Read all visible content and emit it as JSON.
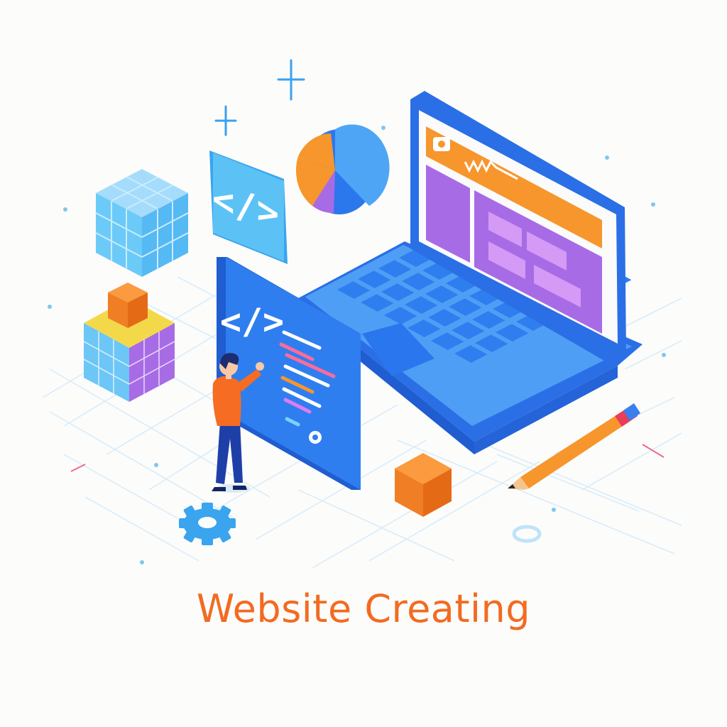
{
  "caption": {
    "text": "Website Creating"
  },
  "colors": {
    "background": "#fcfcfb",
    "caption_orange": "#f26b21",
    "primary_blue": "#2f7ef0",
    "light_blue": "#5cc2f6",
    "purple": "#a86be6",
    "orange": "#f78b2a",
    "grid_line": "#d6ecfa"
  },
  "code_panel": {
    "tag_glyph": "</>"
  },
  "code_card": {
    "tag_glyph": "</>"
  },
  "icons": [
    "code-icon",
    "pie-chart-icon",
    "gear-icon",
    "sparkle-icon",
    "pencil-icon",
    "camera-icon"
  ]
}
